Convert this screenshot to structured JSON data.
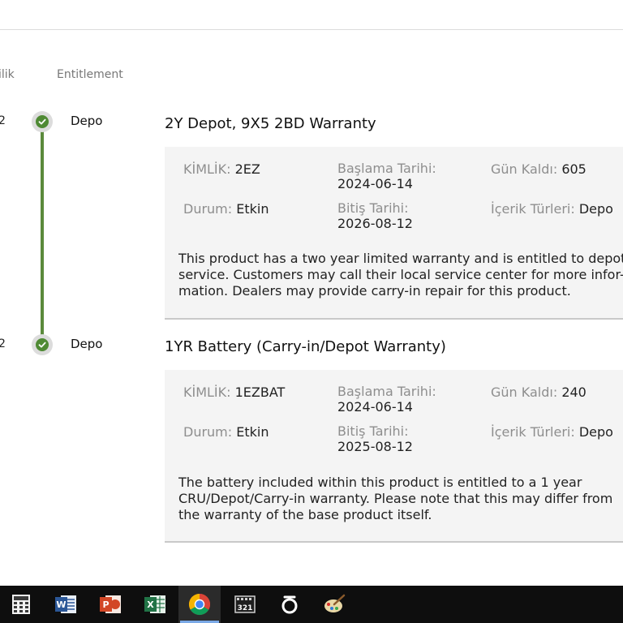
{
  "header": {
    "col_left_partial": "ilik",
    "col_entitlement": "Entitlement"
  },
  "timeline": [
    {
      "date_fragment": "2",
      "label": "Depo"
    },
    {
      "date_fragment": "2",
      "label": "Depo"
    }
  ],
  "warranties": [
    {
      "title": "2Y Depot, 9X5 2BD Warranty",
      "id_label": "KİMLİK:",
      "id_value": "2EZ",
      "start_label": "Başlama Tarihi:",
      "start_value": "2024-06-14",
      "days_label": "Gün Kaldı:",
      "days_value": "605",
      "status_label": "Durum:",
      "status_value": "Etkin",
      "end_label": "Bitiş Tarihi:",
      "end_value": "2026-08-12",
      "content_label": "İçerik Türleri:",
      "content_value": "Depo",
      "desc_lines": [
        "This product has a two year limited warranty and is entitled to depot",
        "service. Customers may call their local service center for more infor-",
        "mation. Dealers may provide carry-in repair for this product."
      ]
    },
    {
      "title": "1YR Battery (Carry-in/Depot Warranty)",
      "id_label": "KİMLİK:",
      "id_value": "1EZBAT",
      "start_label": "Başlama Tarihi:",
      "start_value": "2024-06-14",
      "days_label": "Gün Kaldı:",
      "days_value": "240",
      "status_label": "Durum:",
      "status_value": "Etkin",
      "end_label": "Bitiş Tarihi:",
      "end_value": "2025-08-12",
      "content_label": "İçerik Türleri:",
      "content_value": "Depo",
      "desc_lines": [
        "The battery included within this product is entitled to a 1 year",
        "CRU/Depot/Carry-in warranty. Please note that this may differ from",
        "the warranty of the base product itself."
      ]
    }
  ],
  "taskbar": {
    "icons": [
      "calculator-icon",
      "word-icon",
      "powerpoint-icon",
      "excel-icon",
      "chrome-icon",
      "video-player-icon",
      "ring-app-icon",
      "paint-icon"
    ],
    "active_icon": "chrome-icon",
    "excel_letter": "X",
    "word_letter": "W",
    "ppt_letter": "P",
    "video_text": "321"
  }
}
